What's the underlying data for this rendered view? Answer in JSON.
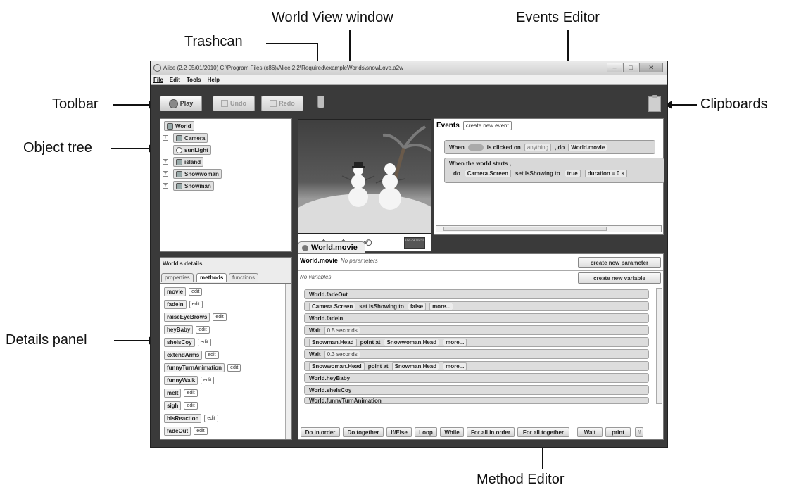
{
  "callouts": {
    "world_view": "World View window",
    "events_editor": "Events Editor",
    "trashcan": "Trashcan",
    "toolbar": "Toolbar",
    "clipboards": "Clipboards",
    "object_tree": "Object tree",
    "details_panel": "Details panel",
    "method_editor": "Method Editor"
  },
  "window": {
    "title": "Alice (2.2  05/01/2010) C:\\Program Files (x86)\\Alice 2.2\\Required\\exampleWorlds\\snowLove.a2w",
    "menu": [
      "File",
      "Edit",
      "Tools",
      "Help"
    ]
  },
  "toolbar": {
    "play": "Play",
    "undo": "Undo",
    "redo": "Redo"
  },
  "object_tree": {
    "items": [
      "World",
      "Camera",
      "sunLight",
      "island",
      "Snowwoman",
      "Snowman"
    ]
  },
  "details": {
    "header": "World's details",
    "tabs": [
      "properties",
      "methods",
      "functions"
    ],
    "edit_label": "edit",
    "methods": [
      "movie",
      "fadeIn",
      "raiseEyeBrows",
      "heyBaby",
      "sheIsCoy",
      "extendArms",
      "funnyTurnAnimation",
      "funnyWalk",
      "melt",
      "sigh",
      "hisReaction",
      "fadeOut"
    ]
  },
  "events": {
    "title": "Events",
    "create_button": "create new event",
    "row1": {
      "when": "When",
      "is_clicked_on": "is clicked on",
      "anything": "anything",
      "do": ", do",
      "method": "World.movie"
    },
    "row2": {
      "label": "When the world starts ,",
      "do": "do",
      "target": "Camera.Screen",
      "set": "set isShowing to",
      "value": "true",
      "duration": "duration = 0 s"
    }
  },
  "method_editor": {
    "tab": "World.movie",
    "header_name": "World.movie",
    "no_params": "No parameters",
    "no_vars": "No variables",
    "create_param": "create new parameter",
    "create_var": "create new variable",
    "statements": [
      {
        "t": "World.fadeOut"
      },
      {
        "t": "Camera.Screen",
        "a": "set isShowing to",
        "b": "false",
        "c": "more..."
      },
      {
        "t": "World.fadeIn"
      },
      {
        "t": "Wait",
        "a": "0.5 seconds"
      },
      {
        "t": "Snowman.Head",
        "a": "point at",
        "b": "Snowwoman.Head",
        "c": "more..."
      },
      {
        "t": "Wait",
        "a": "0.3 seconds"
      },
      {
        "t": "Snowwoman.Head",
        "a": "point at",
        "b": "Snowman.Head",
        "c": "more..."
      },
      {
        "t": "World.heyBaby"
      },
      {
        "t": "World.sheIsCoy"
      },
      {
        "t": "World.funnyTurnAnimation"
      }
    ],
    "bottom_buttons": [
      "Do in order",
      "Do together",
      "If/Else",
      "Loop",
      "While",
      "For all in order",
      "For all together",
      "Wait",
      "print"
    ]
  },
  "world_view": {
    "add_objects": "ADD OBJECTS"
  },
  "colors": {
    "window_bg": "#3a3a3a",
    "panel_bg": "#ffffff",
    "block_bg": "#dddddd",
    "sky_top": "#3f3f3f",
    "ground": "#d9d9d9"
  }
}
